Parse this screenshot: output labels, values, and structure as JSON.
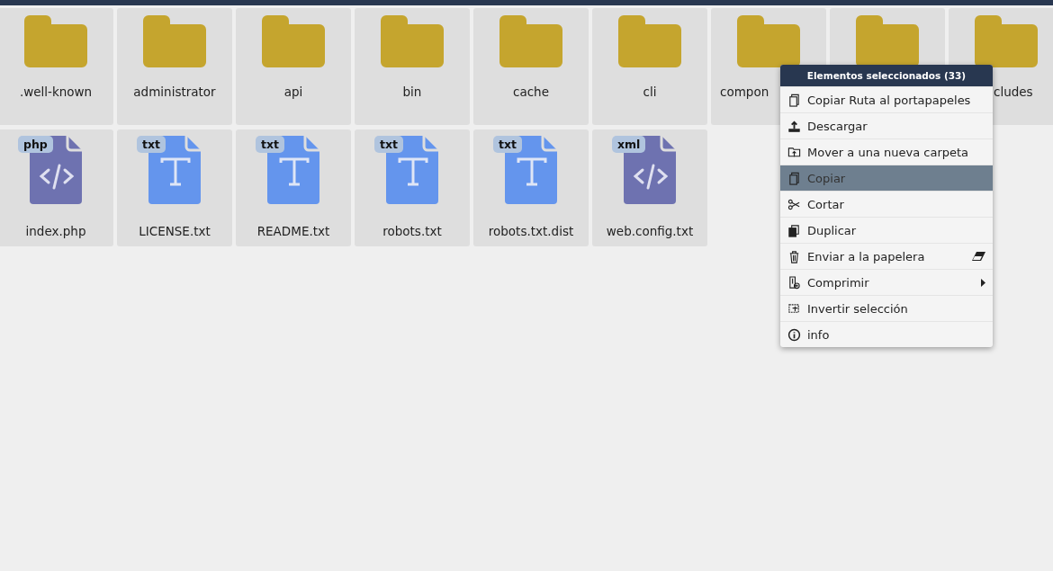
{
  "files": [
    {
      "kind": "folder",
      "name": ".well-known"
    },
    {
      "kind": "folder",
      "name": "administrator"
    },
    {
      "kind": "folder",
      "name": "api"
    },
    {
      "kind": "folder",
      "name": "bin"
    },
    {
      "kind": "folder",
      "name": "cache"
    },
    {
      "kind": "folder",
      "name": "cli"
    },
    {
      "kind": "folder",
      "name": "compon",
      "cut_off_end": true
    },
    {
      "kind": "folder"
    },
    {
      "kind": "folder",
      "name": "cludes",
      "cut_off_start": true
    },
    {
      "kind": "code",
      "badge": "php",
      "name": "index.php"
    },
    {
      "kind": "text",
      "badge": "txt",
      "name": "LICENSE.txt"
    },
    {
      "kind": "text",
      "badge": "txt",
      "name": "README.txt"
    },
    {
      "kind": "text",
      "badge": "txt",
      "name": "robots.txt"
    },
    {
      "kind": "text",
      "badge": "txt",
      "name": "robots.txt.dist"
    },
    {
      "kind": "code",
      "badge": "xml",
      "name": "web.config.txt"
    }
  ],
  "context_menu": {
    "title": "Elementos seleccionados (33)",
    "items": [
      {
        "label": "Copiar Ruta al portapapeles",
        "selected": false
      },
      {
        "label": "Descargar",
        "selected": false
      },
      {
        "label": "Mover a una nueva carpeta",
        "selected": false
      },
      {
        "label": "Copiar",
        "selected": true
      },
      {
        "label": "Cortar",
        "selected": false
      },
      {
        "label": "Duplicar",
        "selected": false
      },
      {
        "label": "Enviar a la papelera",
        "selected": false,
        "has_shortcut": true
      },
      {
        "label": "Comprimir",
        "selected": false,
        "has_submenu": true
      },
      {
        "label": "Invertir selección",
        "selected": false
      },
      {
        "label": "info",
        "selected": false
      }
    ]
  }
}
